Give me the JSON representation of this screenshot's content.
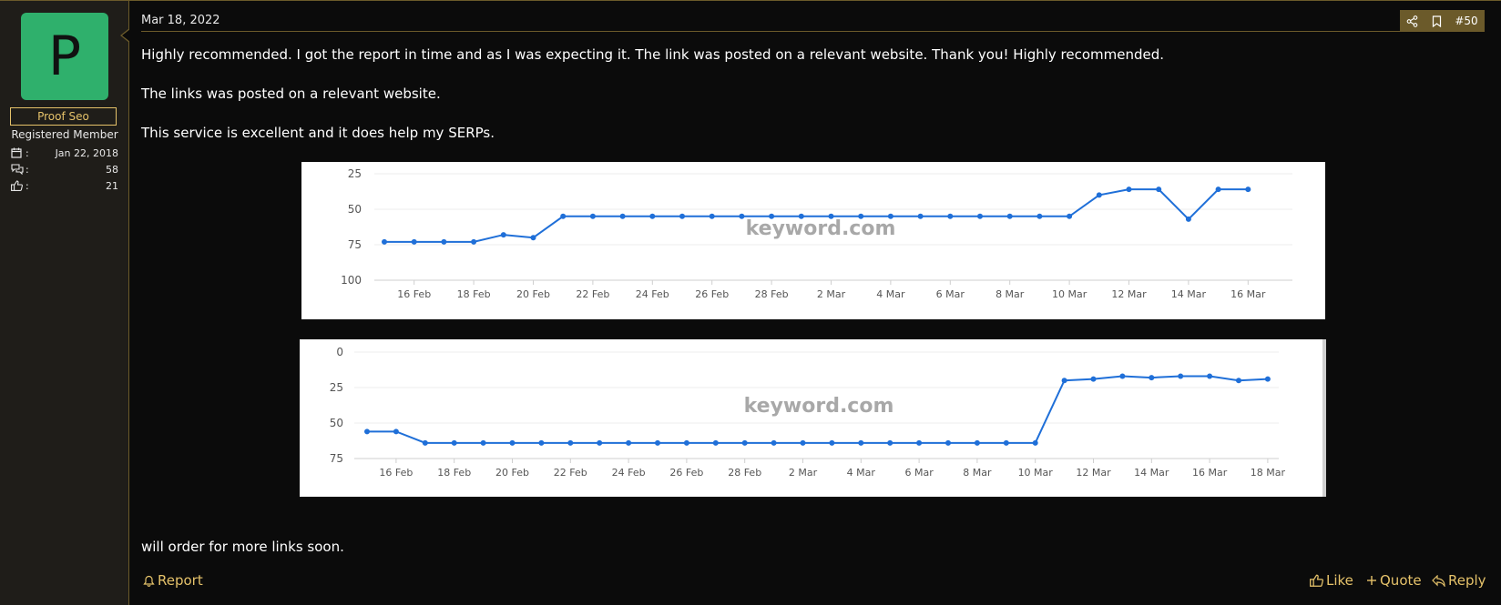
{
  "user": {
    "avatar_letter": "P",
    "name": "Proof Seo",
    "title": "Registered Member",
    "joined": "Jan 22, 2018",
    "messages": "58",
    "reactions": "21"
  },
  "post": {
    "date": "Mar 18, 2022",
    "number": "#50",
    "paragraphs": [
      "Highly recommended. I got the report in time and as I was expecting it. The link was posted on a relevant website. Thank you! Highly recommended.",
      "The links was posted on a relevant website.",
      "This service is excellent and it does help my SERPs.",
      "will order for more links soon."
    ]
  },
  "footer": {
    "report": "Report",
    "like": "Like",
    "quote": "Quote",
    "reply": "Reply"
  },
  "colors": {
    "accent": "#e5c26a",
    "line": "#1f6fd8",
    "avatar": "#2fb06c"
  },
  "chart_data": [
    {
      "type": "line",
      "watermark": "keyword.com",
      "ylim": [
        25,
        100
      ],
      "y_reversed": true,
      "y_ticks": [
        25,
        50,
        75,
        100
      ],
      "x_tick_labels": [
        "16 Feb",
        "18 Feb",
        "20 Feb",
        "22 Feb",
        "24 Feb",
        "26 Feb",
        "28 Feb",
        "2 Mar",
        "4 Mar",
        "6 Mar",
        "8 Mar",
        "10 Mar",
        "12 Mar",
        "14 Mar",
        "16 Mar"
      ],
      "x_start": "15 Feb",
      "values": [
        73,
        73,
        73,
        73,
        68,
        70,
        55,
        55,
        55,
        55,
        55,
        55,
        55,
        55,
        55,
        55,
        55,
        55,
        55,
        55,
        55,
        55,
        55,
        55,
        40,
        36,
        36,
        57,
        36,
        36
      ]
    },
    {
      "type": "line",
      "watermark": "keyword.com",
      "ylim": [
        0,
        75
      ],
      "y_reversed": true,
      "y_ticks": [
        0,
        25,
        50,
        75
      ],
      "x_tick_labels": [
        "16 Feb",
        "18 Feb",
        "20 Feb",
        "22 Feb",
        "24 Feb",
        "26 Feb",
        "28 Feb",
        "2 Mar",
        "4 Mar",
        "6 Mar",
        "8 Mar",
        "10 Mar",
        "12 Mar",
        "14 Mar",
        "16 Mar",
        "18 Mar"
      ],
      "x_start": "15 Feb",
      "values": [
        56,
        56,
        64,
        64,
        64,
        64,
        64,
        64,
        64,
        64,
        64,
        64,
        64,
        64,
        64,
        64,
        64,
        64,
        64,
        64,
        64,
        64,
        64,
        64,
        20,
        19,
        17,
        18,
        17,
        17,
        20,
        19
      ]
    }
  ]
}
